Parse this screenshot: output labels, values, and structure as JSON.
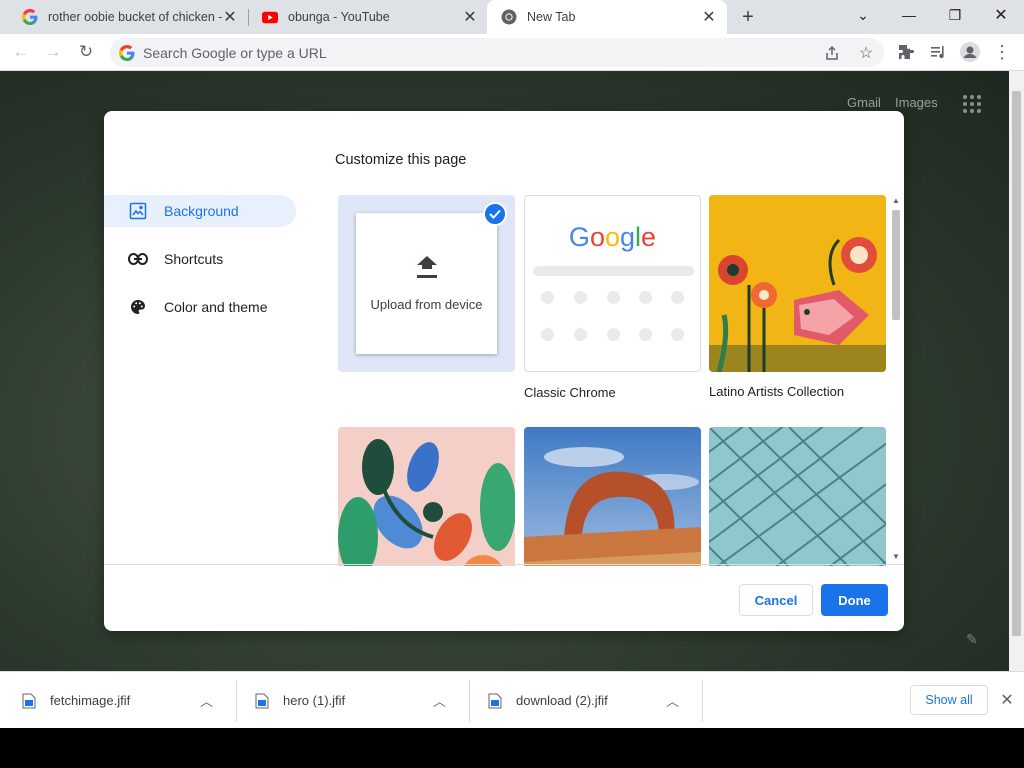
{
  "tabs": [
    {
      "title": "rother oobie bucket of chicken -",
      "favicon": "google-icon",
      "active": false
    },
    {
      "title": "obunga - YouTube",
      "favicon": "youtube-icon",
      "active": false
    },
    {
      "title": "New Tab",
      "favicon": "chrome-icon",
      "active": true
    }
  ],
  "omnibox": {
    "placeholder": "Search Google or type a URL"
  },
  "page": {
    "gmail": "Gmail",
    "images": "Images"
  },
  "dialog": {
    "title": "Customize this page",
    "menu": [
      {
        "label": "Background",
        "icon": "image-icon",
        "selected": true
      },
      {
        "label": "Shortcuts",
        "icon": "link-icon",
        "selected": false
      },
      {
        "label": "Color and theme",
        "icon": "palette-icon",
        "selected": false
      }
    ],
    "tiles": {
      "upload": "Upload from device",
      "classic": "Classic Chrome",
      "classic_logo": "Google",
      "latino": "Latino Artists Collection"
    },
    "cancel": "Cancel",
    "done": "Done"
  },
  "downloads": [
    {
      "name": "fetchimage.jfif"
    },
    {
      "name": "hero (1).jfif"
    },
    {
      "name": "download (2).jfif"
    }
  ],
  "show_all": "Show all",
  "colors": {
    "accent": "#1a73e8",
    "selected_bg": "#e8f0fe"
  }
}
